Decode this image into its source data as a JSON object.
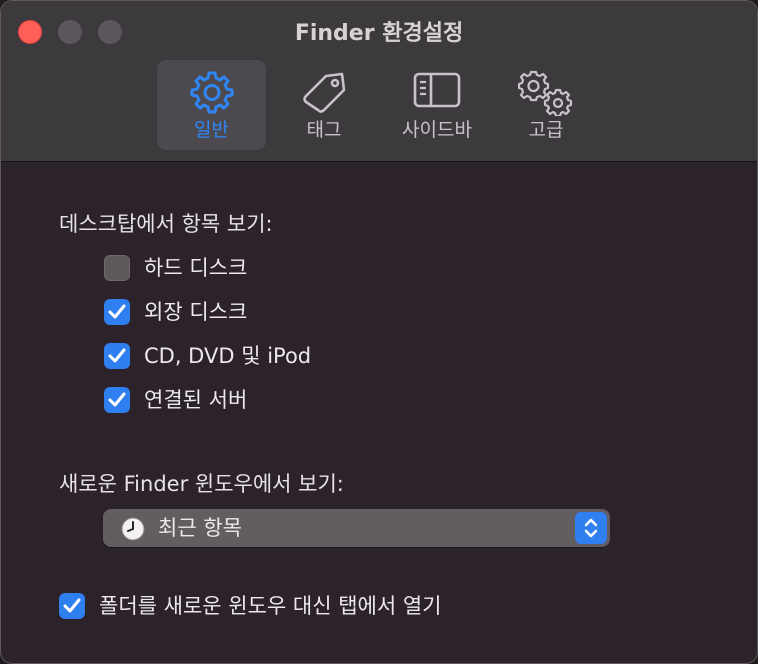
{
  "window": {
    "title": "Finder 환경설정"
  },
  "tabs": [
    {
      "label": "일반",
      "icon": "gear-icon",
      "active": true
    },
    {
      "label": "태그",
      "icon": "tag-icon",
      "active": false
    },
    {
      "label": "사이드바",
      "icon": "sidebar-icon",
      "active": false
    },
    {
      "label": "고급",
      "icon": "gears-icon",
      "active": false
    }
  ],
  "desktop_section": {
    "label": "데스크탑에서 항목 보기:",
    "items": [
      {
        "label": "하드 디스크",
        "checked": false
      },
      {
        "label": "외장 디스크",
        "checked": true
      },
      {
        "label": "CD, DVD 및 iPod",
        "checked": true
      },
      {
        "label": "연결된 서버",
        "checked": true
      }
    ]
  },
  "new_window_section": {
    "label": "새로운 Finder 윈도우에서 보기:",
    "selected": "최근 항목",
    "icon": "clock-icon"
  },
  "open_folders": {
    "label": "폴더를 새로운 윈도우 대신 탭에서 열기",
    "checked": true
  },
  "colors": {
    "accent": "#2f7ff0",
    "close_button": "#ff5f57",
    "window_bg": "#2b2329",
    "toolbar_bg": "#3d3a3e"
  }
}
